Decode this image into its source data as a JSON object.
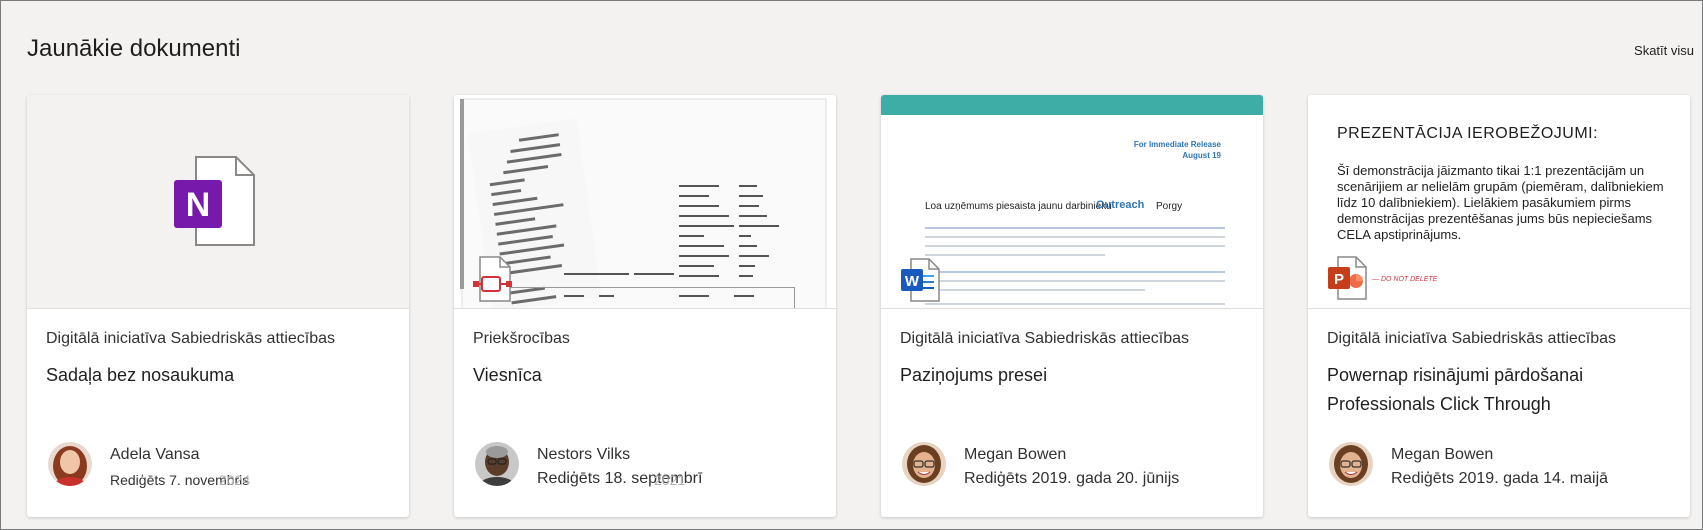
{
  "header": {
    "title": "Jaunākie dokumenti",
    "see_all": "Skatīt visu"
  },
  "cards": [
    {
      "app_icon": "onenote-icon",
      "app_letter": "N",
      "site": "Digitālā iniciatīva Sabiedriskās attiecības",
      "title": "Sadaļa bez nosaukuma",
      "person": "Adela Vansa",
      "edited": "Rediģēts 7. novembris",
      "ghost": "2024"
    },
    {
      "app_icon": "pdf-icon",
      "site": "Priekšrocības",
      "title": "Viesnīca",
      "person": "Nestors Vilks",
      "edited": "Rediģēts 18. septembrī",
      "ghost": "2021"
    },
    {
      "app_icon": "word-icon",
      "app_letter": "W",
      "site": "Digitālā iniciatīva Sabiedriskās attiecības",
      "title": "Paziņojums presei",
      "person": "Megan Bowen",
      "edited": "Rediģēts 2019. gada 20. jūnijs",
      "thumb": {
        "release1": "For Immediate Release",
        "release2": "August 19",
        "heading": "Loa uzņēmums piesaista jaunu darbinieku",
        "heading_accent": "Outreach",
        "heading_end": "Porgy"
      }
    },
    {
      "app_icon": "powerpoint-icon",
      "app_letter": "P",
      "site": "Digitālā iniciatīva Sabiedriskās attiecības",
      "title": "Powernap risinājumi pārdošanai Professionals Click Through",
      "person": "Megan Bowen",
      "edited": "Rediģēts 2019. gada 14. maijā",
      "thumb": {
        "heading": "PREZENTĀCIJA  IEROBEŽOJUMI:",
        "body": "Šī demonstrācija jāizmanto tikai 1:1 prezentācijām un scenārijiem ar nelielām grupām (piemēram, dalībniekiem līdz 10 dalībniekiem). Lielākiem pasākumiem pirms demonstrācijas prezentēšanas jums būs nepieciešams CELA apstiprinājums.",
        "note": "— DO NOT DELETE"
      }
    }
  ],
  "colors": {
    "onenote": "#7719aa",
    "word": "#185abd",
    "powerpoint": "#c43e1c",
    "teal": "#3eada5"
  }
}
